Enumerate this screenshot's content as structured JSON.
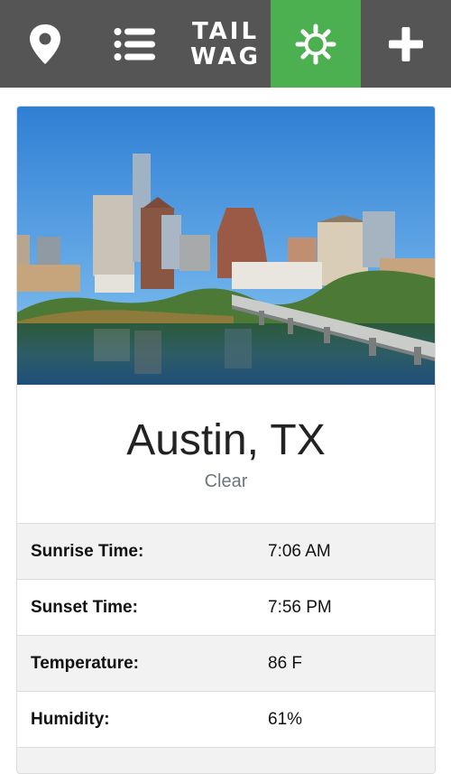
{
  "nav": {
    "logo_line1": "TAIL",
    "logo_line2": "WAG",
    "active_color": "#4cb050",
    "bar_color": "#555555",
    "icons": [
      "map-pin-icon",
      "list-icon",
      "sun-icon",
      "plus-icon"
    ]
  },
  "location": {
    "city": "Austin, TX",
    "condition": "Clear"
  },
  "stats": [
    {
      "label": "Sunrise Time:",
      "value": "7:06 AM"
    },
    {
      "label": "Sunset Time:",
      "value": "7:56 PM"
    },
    {
      "label": "Temperature:",
      "value": "86 F"
    },
    {
      "label": "Humidity:",
      "value": "61%"
    },
    {
      "label": "",
      "value": ""
    }
  ]
}
